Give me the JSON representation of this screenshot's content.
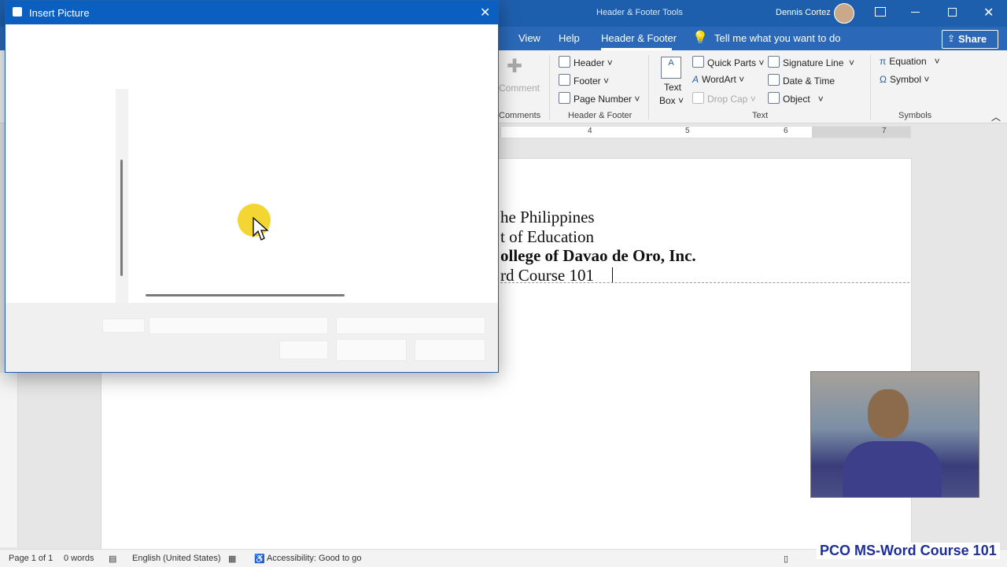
{
  "window": {
    "contextual_tab_title": "Header & Footer Tools",
    "user_name": "Dennis Cortez"
  },
  "tabs": {
    "view": "View",
    "help": "Help",
    "header_footer": "Header & Footer",
    "tell_me": "Tell me what you want to do",
    "share": "Share"
  },
  "ribbon": {
    "comment": "Comment",
    "comments_group": "Comments",
    "header": "Header",
    "footer": "Footer",
    "page_number": "Page Number",
    "hf_group": "Header & Footer",
    "text_box_1": "Text",
    "text_box_2": "Box",
    "quick_parts": "Quick Parts",
    "wordart": "WordArt",
    "drop_cap": "Drop Cap",
    "signature_line": "Signature Line",
    "date_time": "Date & Time",
    "object": "Object",
    "text_group": "Text",
    "equation": "Equation",
    "symbol": "Symbol",
    "symbols_group": "Symbols"
  },
  "ruler": {
    "labels": [
      "4",
      "5",
      "6",
      "7"
    ]
  },
  "document": {
    "line1": "he Philippines",
    "line2": "t of Education",
    "line3": "ollege of Davao de Oro, Inc.",
    "line4": "rd Course 101"
  },
  "dialog": {
    "title": "Insert Picture"
  },
  "statusbar": {
    "page": "Page 1 of 1",
    "words": "0 words",
    "language": "English (United States)",
    "accessibility": "Accessibility: Good to go"
  },
  "overlay": {
    "brand": "PCO MS-Word Course 101"
  }
}
